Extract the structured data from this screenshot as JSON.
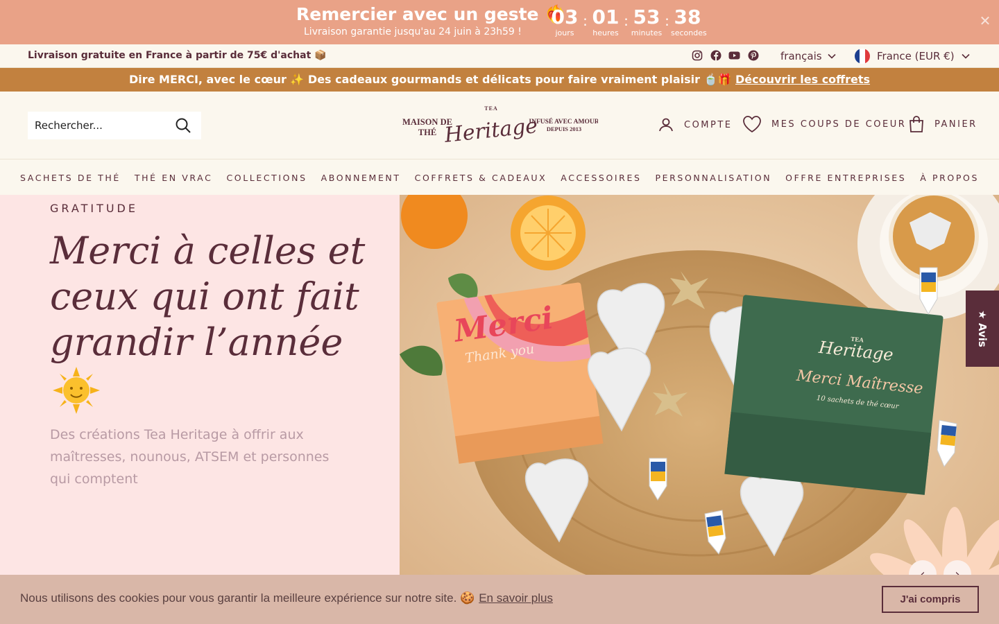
{
  "countdown": {
    "title": "Remercier avec un geste ❤️‍🔥",
    "subtitle": "Livraison garantie jusqu'au 24 juin à 23h59 !",
    "units": [
      {
        "value": "03",
        "label": "jours"
      },
      {
        "value": "01",
        "label": "heures"
      },
      {
        "value": "53",
        "label": "minutes"
      },
      {
        "value": "38",
        "label": "secondes"
      }
    ],
    "separator": ":",
    "close": "✕"
  },
  "utility": {
    "free_shipping": "Livraison gratuite en France à partir de 75€ d'achat 📦",
    "socials": [
      "instagram-icon",
      "facebook-icon",
      "youtube-icon",
      "pinterest-icon"
    ],
    "language": "français",
    "country": "France (EUR €)"
  },
  "promo": {
    "text": "Dire MERCI, avec le cœur ✨ Des cadeaux gourmands et délicats pour faire vraiment plaisir 🍵🎁 ",
    "link": "Découvrir les coffrets"
  },
  "header": {
    "search_placeholder": "Rechercher...",
    "logo": {
      "left": "MAISON DE",
      "left2": "THÉ",
      "tea": "TEA",
      "brand": "Heritage",
      "right": "INFUSÉ AVEC AMOUR",
      "right2": "DEPUIS 2013"
    },
    "account": "COMPTE",
    "wishlist": "MES COUPS DE COEUR",
    "cart": "PANIER"
  },
  "nav": {
    "items": [
      "SACHETS DE THÉ",
      "THÉ EN VRAC",
      "COLLECTIONS",
      "ABONNEMENT",
      "COFFRETS & CADEAUX",
      "ACCESSOIRES",
      "PERSONNALISATION",
      "OFFRE ENTREPRISES",
      "À PROPOS"
    ]
  },
  "hero": {
    "eyebrow": "GRATITUDE",
    "title": "Merci à celles et ceux qui ont fait grandir l’année",
    "description": "Des créations Tea Heritage à offrir aux maîtresses, nounous, ATSEM et personnes qui comptent",
    "image": {
      "box_left_title": "Merci",
      "box_left_sub": "Thank you",
      "box_right_brand": "Heritage",
      "box_right_tea": "TEA",
      "box_right_title": "Merci Maîtresse",
      "box_right_sub": "10 sachets de thé cœur"
    },
    "prev": "‹",
    "next": "›"
  },
  "avis": "★ Avis",
  "cookie": {
    "text": "Nous utilisons des cookies pour vous garantir la meilleure expérience sur notre site. 🍪",
    "link": "En savoir plus",
    "button": "J'ai compris"
  },
  "colors": {
    "countdown_bg": "#e9a287",
    "promo_bg": "#c2813f",
    "brand": "#5a2d3a",
    "hero_bg": "#fde5e4",
    "cookie_bg": "#d9b7a8"
  }
}
